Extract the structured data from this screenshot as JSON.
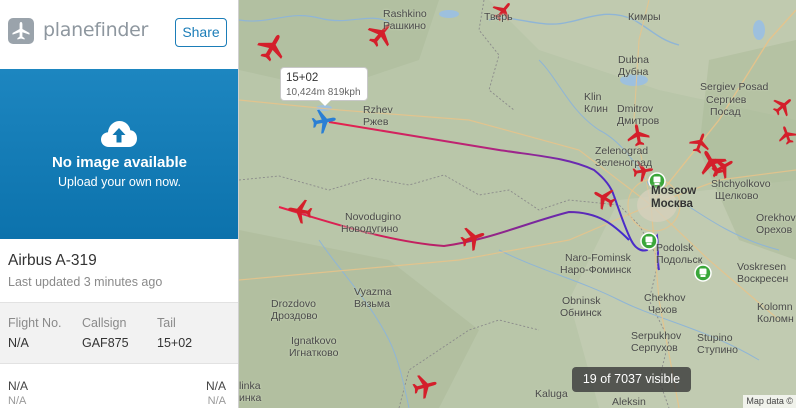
{
  "sidebar": {
    "logo_text": "planefinder",
    "share_label": "Share",
    "photo": {
      "title": "No image available",
      "subtitle": "Upload your own now."
    },
    "aircraft_type": "Airbus A-319",
    "last_updated": "Last updated 3 minutes ago",
    "details": {
      "flight_no_label": "Flight No.",
      "flight_no_value": "N/A",
      "callsign_label": "Callsign",
      "callsign_value": "GAF875",
      "tail_label": "Tail",
      "tail_value": "15+02"
    },
    "route": {
      "origin": "N/A",
      "origin_sub": "N/A",
      "destination": "N/A",
      "destination_sub": "N/A"
    }
  },
  "map": {
    "tooltip": {
      "callsign": "15+02",
      "stats": "10,424m 819kph"
    },
    "visible_count": "19 of 7037 visible",
    "credit": "Map data ©",
    "cities": {
      "tver": "Тверь",
      "kimry": "Кимры",
      "rashkino_lat": "Rashkino",
      "rashkino_cyr": "Рашкино",
      "dubna_lat": "Dubna",
      "dubna_cyr": "Дубна",
      "sergiev_lat": "Sergiev Posad",
      "sergiev_cyr1": "Сергиев",
      "sergiev_cyr2": "Посад",
      "klin_lat": "Klin",
      "klin_cyr": "Клин",
      "dmitrov_lat": "Dmitrov",
      "dmitrov_cyr": "Дмитров",
      "rzhev_lat": "Rzhev",
      "rzhev_cyr": "Ржев",
      "zelenograd_lat": "Zelenograd",
      "zelenograd_cyr": "Зеленоград",
      "shchyolkovo_lat": "Shchyolkovo",
      "shchyolkovo_cyr": "Щелково",
      "moscow_lat": "Moscow",
      "moscow_cyr": "Москва",
      "novodugino_lat": "Novodugino",
      "novodugino_cyr": "Новодугино",
      "orekhovo_lat": "Orekhov",
      "orekhovo_cyr": "Орехов",
      "podolsk_lat": "Podolsk",
      "podolsk_cyr": "Подольск",
      "naro_lat": "Naro-Fominsk",
      "naro_cyr": "Наро-Фоминск",
      "voskresensk_lat": "Voskresen",
      "voskresensk_cyr": "Воскресен",
      "drozdovo_lat": "Drozdovo",
      "drozdovo_cyr": "Дроздово",
      "vyazma_lat": "Vyazma",
      "vyazma_cyr": "Вязьма",
      "chekhov_lat": "Chekhov",
      "chekhov_cyr": "Чехов",
      "kolomna_lat": "Kolomn",
      "kolomna_cyr": "Коломн",
      "obninsk_lat": "Obninsk",
      "obninsk_cyr": "Обнинск",
      "ignatkovo_lat": "Ignatkovo",
      "ignatkovo_cyr": "Игнатково",
      "serpukhov_lat": "Serpukhov",
      "serpukhov_cyr": "Серпухов",
      "stupino_lat": "Stupino",
      "stupino_cyr": "Ступино",
      "linka": "linka",
      "inka": "инка",
      "kaluga": "Kaluga",
      "aleksin": "Aleksin"
    }
  },
  "colors": {
    "brand_blue": "#1b7db8",
    "plane_red": "#d41f2b",
    "selected_plane": "#2a7fd4",
    "track_start": "#e8214a",
    "track_end": "#4a2cc8"
  },
  "icons": [
    "airplane-logo-icon",
    "cloud-upload-icon",
    "airplane-icon",
    "airport-icon"
  ]
}
